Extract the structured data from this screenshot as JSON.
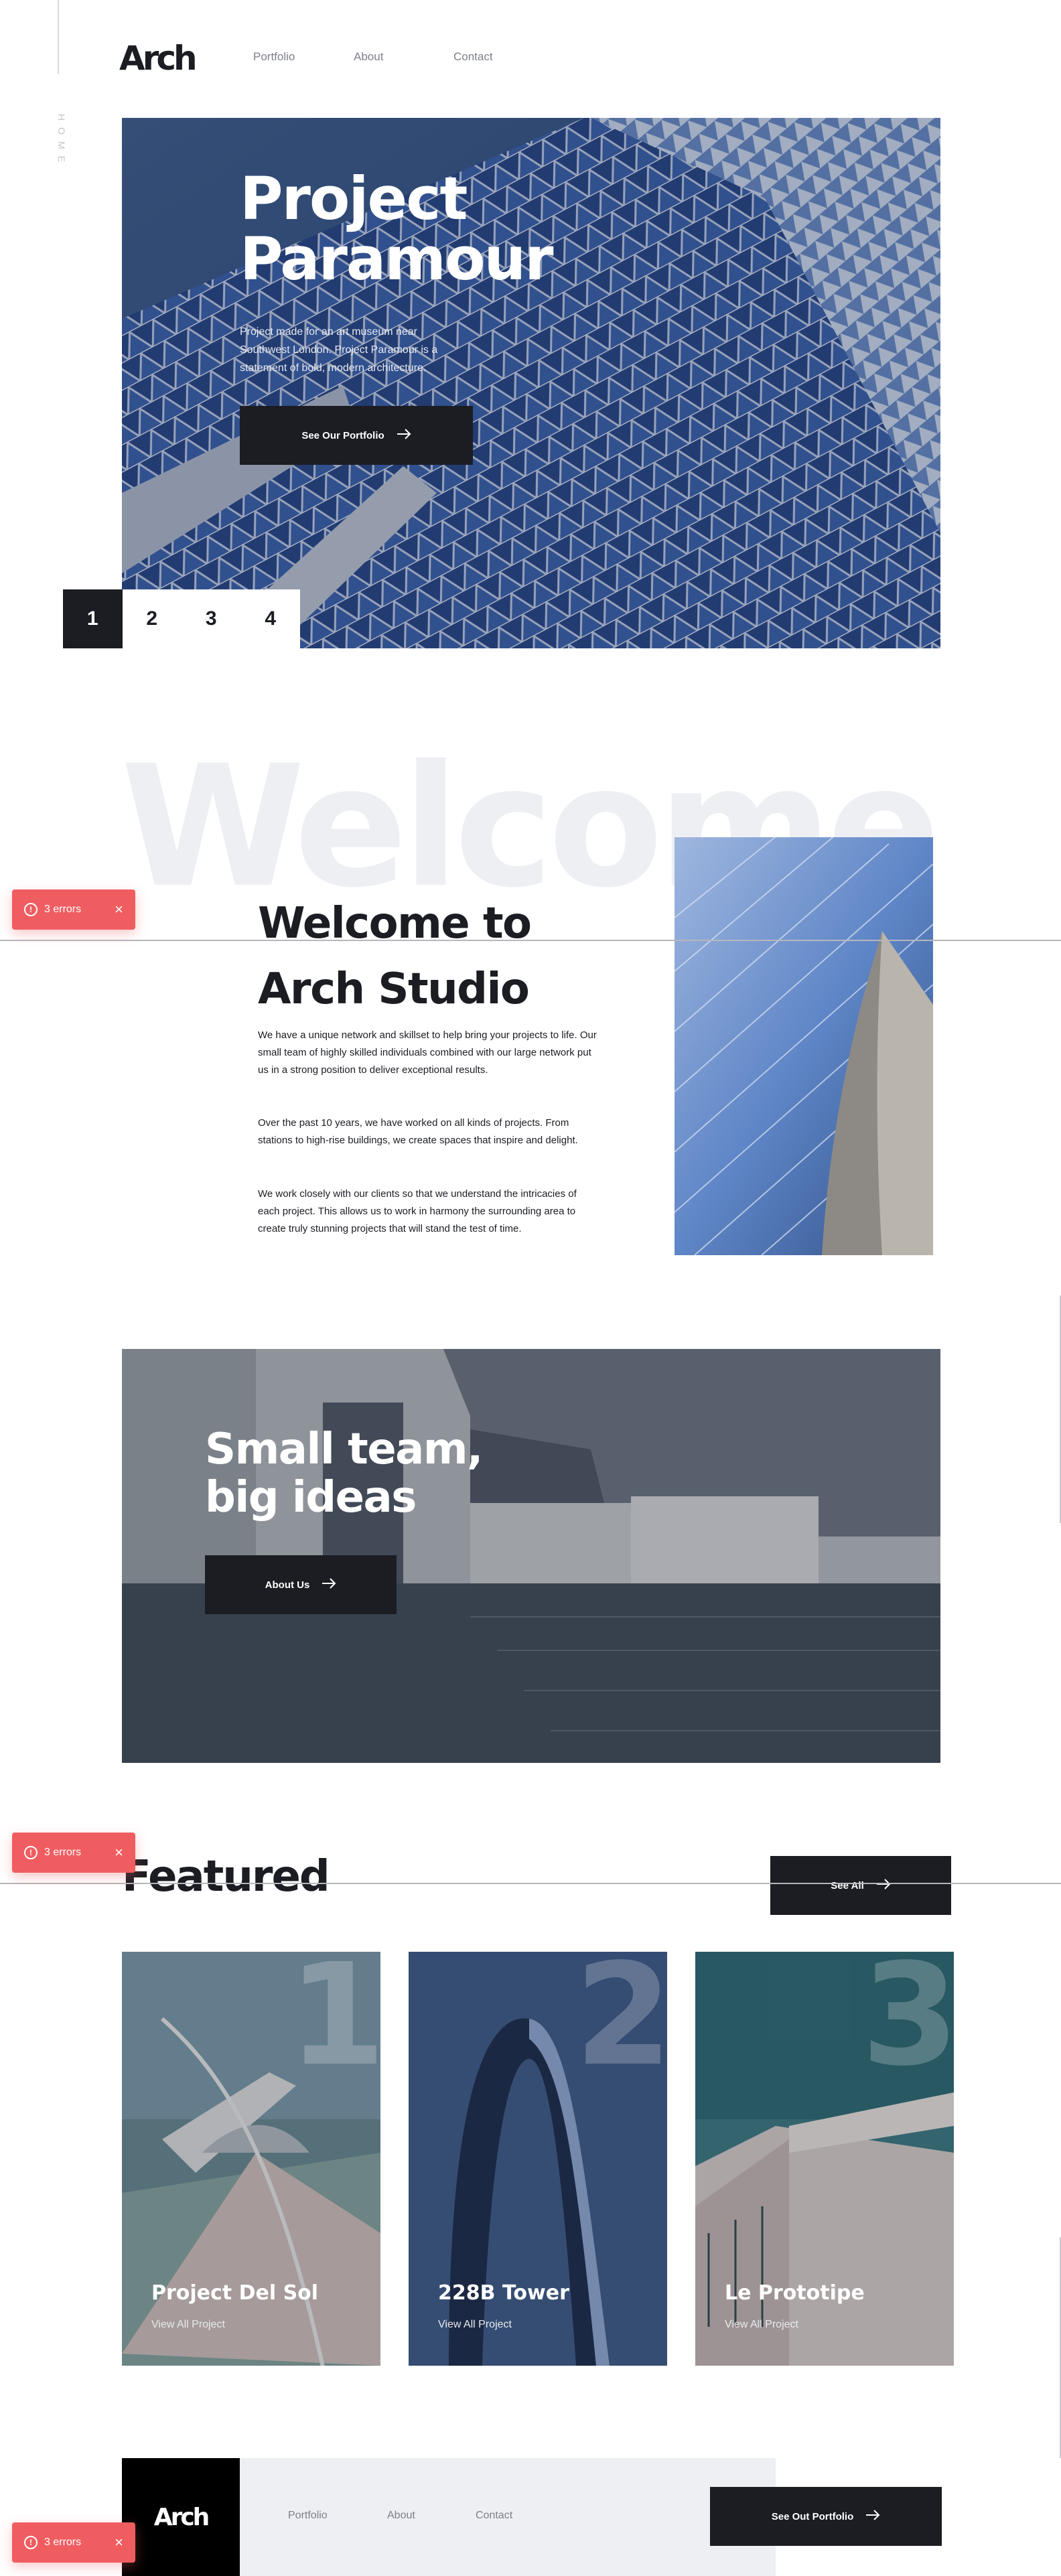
{
  "header": {
    "logo": "Arch",
    "side_label": "HOME",
    "nav": [
      "Portfolio",
      "About",
      "Contact"
    ]
  },
  "hero": {
    "title_line1": "Project",
    "title_line2": "Paramour",
    "description": "Project made for an art museum near Southwest London. Project Paramour is a statement of bold, modern architecture.",
    "button_label": "See Our Portfolio",
    "pager": [
      "1",
      "2",
      "3",
      "4"
    ],
    "active_page": "1"
  },
  "welcome": {
    "bg_word": "Welcome",
    "title_line1": "Welcome to",
    "title_line2": "Arch Studio",
    "paragraphs": [
      "We have a unique network and skillset to help bring your projects to life. Our small team of highly skilled individuals combined with our large network put us in a strong position to deliver exceptional results.",
      "Over the past 10 years, we have worked on all kinds of projects. From stations to high-rise buildings, we create spaces that inspire and delight.",
      "We work closely with our clients so that we understand the intricacies of each project. This allows us to work in harmony the surrounding area to create truly stunning projects that will stand the test of time."
    ]
  },
  "team": {
    "title_line1": "Small team,",
    "title_line2": "big ideas",
    "button_label": "About Us"
  },
  "featured": {
    "title": "Featured",
    "see_all": "See All",
    "cards": [
      {
        "number": "1",
        "title": "Project Del Sol",
        "link": "View All Project"
      },
      {
        "number": "2",
        "title": "228B Tower",
        "link": "View All Project"
      },
      {
        "number": "3",
        "title": "Le Prototipe",
        "link": "View All Project"
      }
    ]
  },
  "footer": {
    "logo": "Arch",
    "nav": [
      "Portfolio",
      "About",
      "Contact"
    ],
    "button_label": "See Out Portfolio"
  },
  "errors": {
    "label": "3 errors",
    "icon": "!",
    "close": "×"
  },
  "colors": {
    "dark": "#1b1d23",
    "light_gray": "#eeeff3",
    "error": "#f05d61",
    "text_gray": "#7d808a"
  }
}
